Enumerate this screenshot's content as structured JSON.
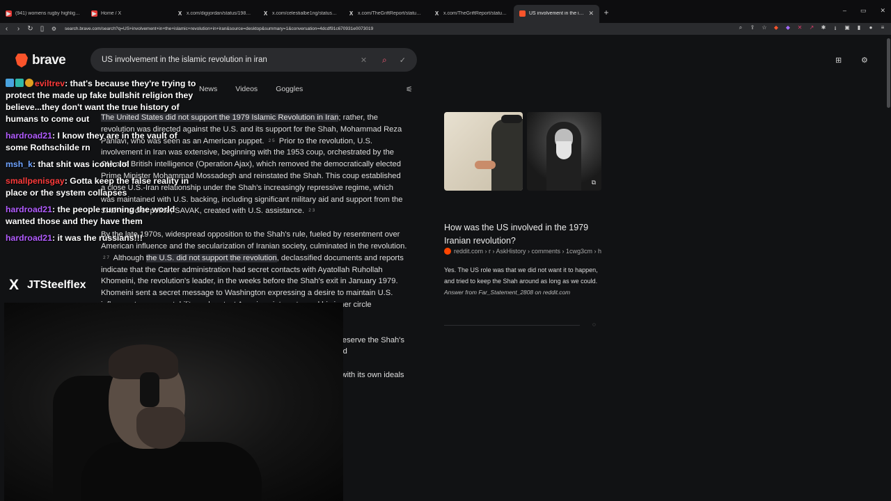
{
  "tabs": [
    {
      "title": "(941) womens rugby highlights - Yo",
      "icon": "youtube-icon",
      "active": false,
      "fav_color": "#e53935",
      "fav_glyph": "▶"
    },
    {
      "title": "Home / X",
      "icon": "x-icon",
      "active": false,
      "fav_color": "#e53935",
      "fav_glyph": "▶"
    },
    {
      "title": "x.com/digijordan/status/19815233",
      "icon": "x-icon",
      "active": false,
      "fav_color": "transparent",
      "fav_glyph": "X"
    },
    {
      "title": "x.com/celestialbe1ng/status/19809",
      "icon": "x-icon",
      "active": false,
      "fav_color": "transparent",
      "fav_glyph": "X"
    },
    {
      "title": "x.com/TheGriftReport/status/19813",
      "icon": "x-icon",
      "active": false,
      "fav_color": "transparent",
      "fav_glyph": "X"
    },
    {
      "title": "x.com/TheGriftReport/status/19813",
      "icon": "x-icon",
      "active": false,
      "fav_color": "transparent",
      "fav_glyph": "X"
    },
    {
      "title": "US involvement in the islamic re",
      "icon": "brave-icon",
      "active": true,
      "fav_color": "#fb542b",
      "fav_glyph": ""
    }
  ],
  "address_bar": {
    "url": "search.brave.com/search?q=US+involvement+in+the+islamic+revolution+in+iran&source=desktop&summary=1&conversation=4dcdf91c670931e0073019"
  },
  "brand": {
    "logo_text": "brave"
  },
  "search": {
    "query": "US involvement in the islamic revolution in iran"
  },
  "nav_tabs": [
    "News",
    "Videos",
    "Goggles"
  ],
  "answer": {
    "p1": {
      "hl": "The United States did not support the 1979 Islamic Revolution in Iran",
      "a": "; rather, the revolution was directed against the U.S. and its support for the Shah, Mohammad Reza Pahlavi, who was seen as an American puppet.",
      "c1": "2 5",
      "b": "Prior to the revolution, U.S. involvement in Iran was extensive, beginning with the 1953 coup, orchestrated by the CIA and British intelligence (Operation Ajax), which removed the democratically elected Prime Minister Mohammad Mossadegh and reinstated the Shah. This coup established a close U.S.-Iran relationship under the Shah's increasingly repressive regime, which was maintained with U.S. backing, including significant military aid and support from the Shah's secret police, SAVAK, created with U.S. assistance.",
      "c2": "2 3"
    },
    "p2": {
      "a": "By the late 1970s, widespread opposition to the Shah's rule, fueled by resentment over American influence and the secularization of Iranian society, culminated in the revolution.",
      "c1": "2 7",
      "b": "Although",
      "hl": "the U.S. did not support the revolution",
      "c": ", declassified documents and reports indicate that the Carter administration had secret contacts with Ayatollah Ruhollah Khomeini, the revolution's leader, in the weeks before the Shah's exit in January 1979. Khomeini sent a secret message to Washington expressing a desire to maintain U.S. influence to ensure stability and protect American interests, and his inner circle supported the revolution.",
      "c2": "6"
    },
    "p3": {
      "a": "The U.S. was largely caught off guard by the revolution; attempts to preserve the Shah's regime backfired by inadvertently pushing the Shah into the danger and"
    },
    "p4": {
      "a": "Critics argue U.S. support for the Shah's regime—sometimes at odds with its own ideals—resulted in creating the"
    }
  },
  "images": [
    {
      "alt": "Khomeini illustration"
    },
    {
      "alt": "Khomeini photo"
    }
  ],
  "qa": {
    "title": "How was the US involved in the 1979 Iranian revolution?",
    "source": "reddit.com › r › AskHistory › comments › 1cwg3cm › h",
    "body": "Yes. The US role was that we did not want it to happen, and tried to keep the Shah around as long as we could.",
    "attribution": "Answer from Far_Statement_2808 on reddit.com"
  },
  "chat": [
    {
      "user": "eviltrev",
      "color": "#ff3b3b",
      "text": ": that's because they're trying to protect the made up fake bullshit religion they believe...they don't want the true history of humans to come out",
      "badges": true
    },
    {
      "user": "hardroad21",
      "color": "#b25cff",
      "text": ": I know they are in the vault of some Rothschilde rn",
      "badges": false
    },
    {
      "user": "msh_k",
      "color": "#6fa3ff",
      "text": ": that shit was iconic lol",
      "badges": false
    },
    {
      "user": "smallpenisgay",
      "color": "#ff3b3b",
      "text": ": Gotta keep the false reality in place or the system collapses",
      "badges": false
    },
    {
      "user": "hardroad21",
      "color": "#b25cff",
      "text": ": the people running the world wanted those and they have them",
      "badges": false
    },
    {
      "user": "hardroad21",
      "color": "#b25cff",
      "text": ": it was the russians!!!",
      "badges": false
    }
  ],
  "streamer": {
    "handle": "JTSteelflex"
  }
}
